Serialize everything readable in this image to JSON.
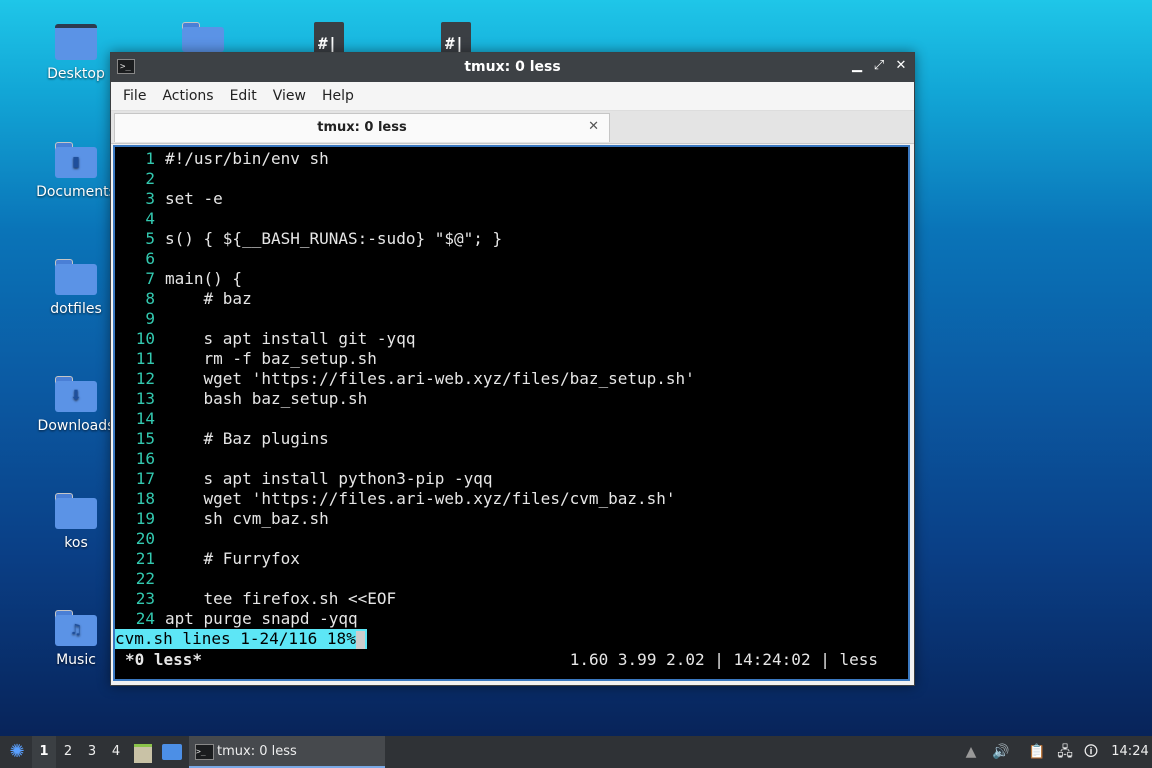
{
  "desktop": {
    "icons": [
      {
        "label": "Desktop"
      },
      {
        "label": "Documents"
      },
      {
        "label": "dotfiles"
      },
      {
        "label": "Downloads"
      },
      {
        "label": "kos"
      },
      {
        "label": "Music"
      }
    ],
    "top_file_glyph": "#|"
  },
  "window": {
    "title": "tmux: 0 less",
    "menu": [
      "File",
      "Actions",
      "Edit",
      "View",
      "Help"
    ],
    "tab_label": "tmux: 0 less"
  },
  "terminal": {
    "lines": [
      {
        "n": "1",
        "text": "#!/usr/bin/env sh"
      },
      {
        "n": "2",
        "text": ""
      },
      {
        "n": "3",
        "text": "set -e"
      },
      {
        "n": "4",
        "text": ""
      },
      {
        "n": "5",
        "text": "s() { ${__BASH_RUNAS:-sudo} \"$@\"; }"
      },
      {
        "n": "6",
        "text": ""
      },
      {
        "n": "7",
        "text": "main() {"
      },
      {
        "n": "8",
        "text": "    # baz"
      },
      {
        "n": "9",
        "text": ""
      },
      {
        "n": "10",
        "text": "    s apt install git -yqq"
      },
      {
        "n": "11",
        "text": "    rm -f baz_setup.sh"
      },
      {
        "n": "12",
        "text": "    wget 'https://files.ari-web.xyz/files/baz_setup.sh'"
      },
      {
        "n": "13",
        "text": "    bash baz_setup.sh"
      },
      {
        "n": "14",
        "text": ""
      },
      {
        "n": "15",
        "text": "    # Baz plugins"
      },
      {
        "n": "16",
        "text": ""
      },
      {
        "n": "17",
        "text": "    s apt install python3-pip -yqq"
      },
      {
        "n": "18",
        "text": "    wget 'https://files.ari-web.xyz/files/cvm_baz.sh'"
      },
      {
        "n": "19",
        "text": "    sh cvm_baz.sh"
      },
      {
        "n": "20",
        "text": ""
      },
      {
        "n": "21",
        "text": "    # Furryfox"
      },
      {
        "n": "22",
        "text": ""
      },
      {
        "n": "23",
        "text": "    tee firefox.sh <<EOF"
      },
      {
        "n": "24",
        "text": "apt purge snapd -yqq"
      }
    ],
    "less_status": "cvm.sh lines 1-24/116 18%",
    "tmux_left": "*0 less*",
    "tmux_right": "1.60 3.99 2.02 | 14:24:02 | less"
  },
  "taskbar": {
    "workspaces": [
      "1",
      "2",
      "3",
      "4"
    ],
    "task_label": "tmux: 0 less",
    "clock": "14:24"
  }
}
